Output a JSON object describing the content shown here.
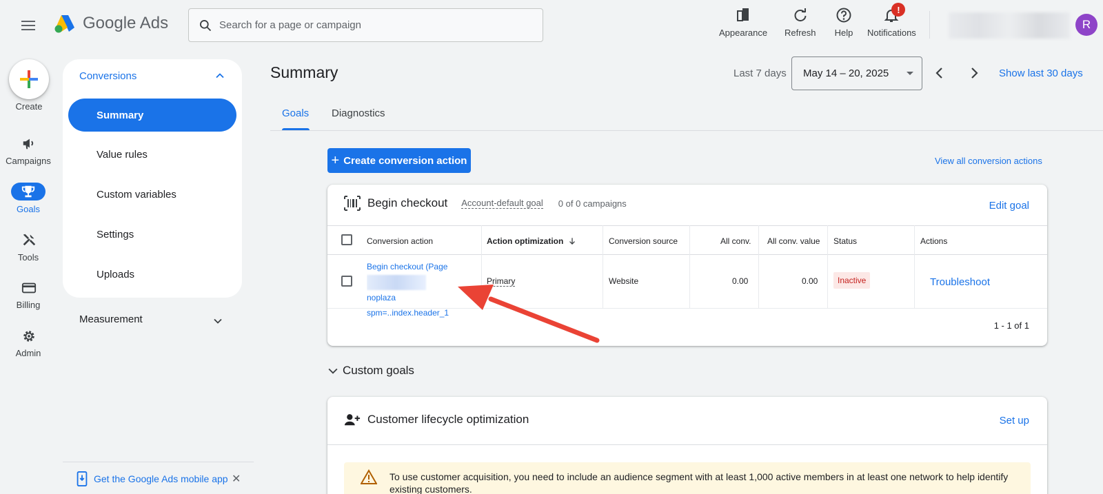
{
  "header": {
    "logo_text": "Google Ads",
    "search_placeholder": "Search for a page or campaign",
    "tools": [
      {
        "label": "Appearance",
        "icon": "appearance-icon"
      },
      {
        "label": "Refresh",
        "icon": "refresh-icon"
      },
      {
        "label": "Help",
        "icon": "help-icon"
      },
      {
        "label": "Notifications",
        "icon": "notifications-icon"
      }
    ],
    "notification_badge": "!",
    "avatar_initial": "R"
  },
  "rail": {
    "create_label": "Create",
    "items": [
      {
        "label": "Campaigns",
        "icon": "megaphone-icon"
      },
      {
        "label": "Goals",
        "icon": "trophy-icon"
      },
      {
        "label": "Tools",
        "icon": "tools-icon"
      },
      {
        "label": "Billing",
        "icon": "credit-card-icon"
      },
      {
        "label": "Admin",
        "icon": "gear-icon"
      }
    ]
  },
  "sidenav": {
    "section_title": "Conversions",
    "items": [
      "Summary",
      "Value rules",
      "Custom variables",
      "Settings",
      "Uploads"
    ],
    "active_item": "Summary",
    "measurement_label": "Measurement",
    "mobile_app_link": "Get the Google Ads mobile app"
  },
  "main": {
    "title": "Summary",
    "range_label": "Last 7 days",
    "date_range": "May 14 – 20, 2025",
    "show_last_30": "Show last 30 days",
    "tabs": [
      "Goals",
      "Diagnostics"
    ],
    "active_tab": "Goals",
    "create_button": "Create conversion action",
    "view_all_link": "View all conversion actions"
  },
  "goal_card": {
    "title": "Begin checkout",
    "default_goal_label": "Account-default goal",
    "campaign_count": "0 of 0 campaigns",
    "edit_link": "Edit goal",
    "columns": [
      "Conversion action",
      "Action optimization",
      "Conversion source",
      "All conv.",
      "All conv. value",
      "Status",
      "Actions"
    ],
    "rows": [
      {
        "action_line1": "Begin checkout (Page",
        "action_line2_suffix": "noplaza",
        "action_line3": "spm=..index.header_1",
        "optimization": "Primary",
        "source": "Website",
        "all_conv": "0.00",
        "all_conv_value": "0.00",
        "status": "Inactive",
        "action": "Troubleshoot"
      }
    ],
    "pagination": "1 - 1 of 1"
  },
  "custom_goals": {
    "label": "Custom goals"
  },
  "lifecycle_card": {
    "title": "Customer lifecycle optimization",
    "setup_link": "Set up",
    "warning_text": "To use customer acquisition, you need to include an audience segment with at least 1,000 active members in at least one network to help identify existing customers."
  },
  "colors": {
    "accent": "#1a73e8",
    "inactive_text": "#c5221f",
    "inactive_bg": "#fce8e6",
    "annotation_arrow": "#ea4335"
  }
}
